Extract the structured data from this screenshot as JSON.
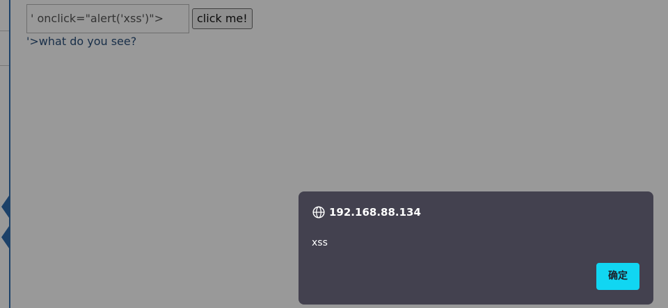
{
  "page": {
    "input_value": "' onclick=\"alert('xss')\">",
    "button_label": "click me!",
    "link_text": "'>what do you see?"
  },
  "dialog": {
    "origin": "192.168.88.134",
    "message": "xss",
    "ok_label": "确定",
    "origin_icon": "globe-icon",
    "accent_color": "#11d6f2",
    "background_color": "#43414f"
  }
}
